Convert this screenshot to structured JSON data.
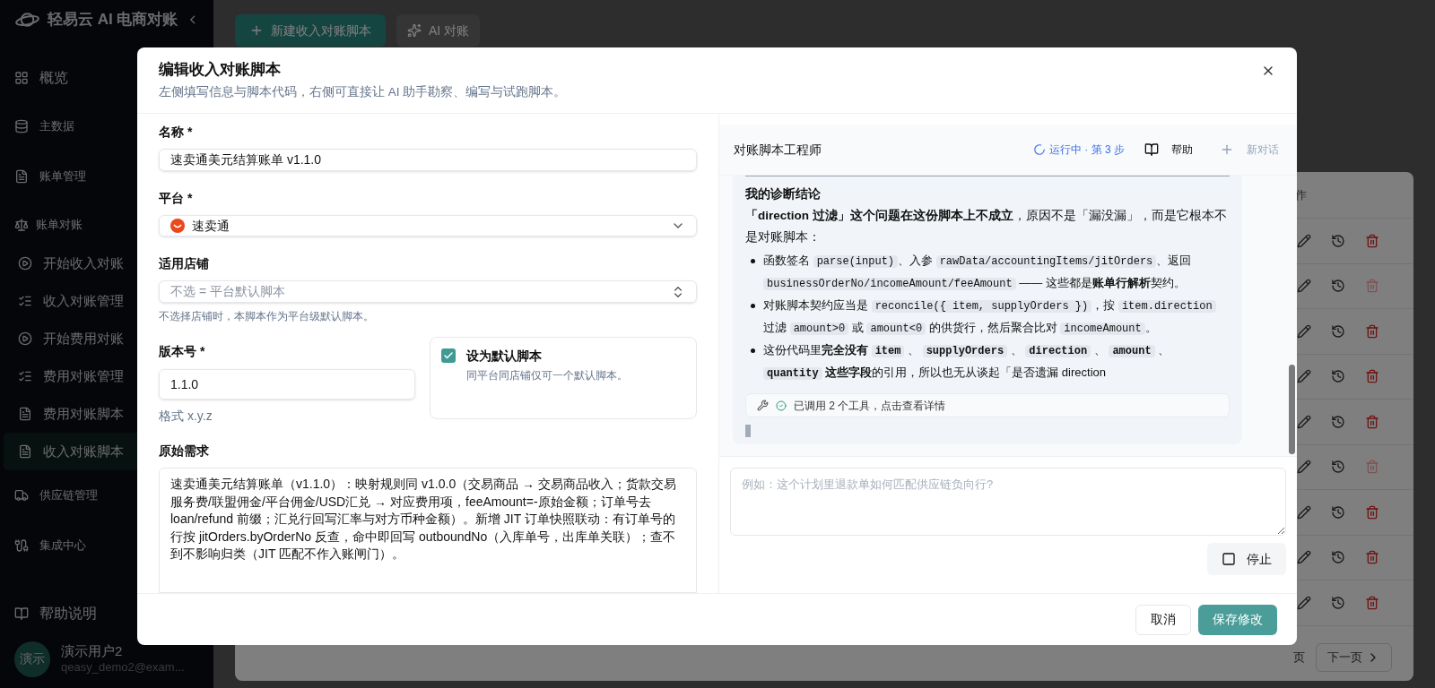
{
  "sidebar": {
    "brand": "轻易云 AI 电商对账",
    "items": [
      {
        "label": "概览",
        "kind": "link"
      },
      {
        "label": "主数据",
        "kind": "group"
      },
      {
        "label": "账单管理",
        "kind": "group"
      },
      {
        "label": "账单对账",
        "kind": "section",
        "children": [
          {
            "label": "开始收入对账",
            "selected": false
          },
          {
            "label": "收入对账管理",
            "selected": false
          },
          {
            "label": "开始费用对账",
            "selected": false
          },
          {
            "label": "费用对账管理",
            "selected": false
          },
          {
            "label": "费用对账脚本",
            "selected": false
          },
          {
            "label": "收入对账脚本",
            "selected": true
          }
        ]
      },
      {
        "label": "供应链管理",
        "kind": "group"
      },
      {
        "label": "集成中心",
        "kind": "group"
      },
      {
        "label": "帮助说明",
        "kind": "link"
      }
    ],
    "user": {
      "avatar": "演示",
      "name": "演示用户2",
      "email": "qeasy_demo2@exam..."
    }
  },
  "toolbar": [
    {
      "label": "新建收入对账脚本",
      "kind": "primary"
    },
    {
      "label": "AI 对账",
      "kind": "ghost"
    }
  ],
  "table": {
    "header": "作",
    "rows": [
      {
        "delete_disabled": false
      },
      {
        "delete_disabled": true
      },
      {
        "delete_disabled": false
      },
      {
        "delete_disabled": false
      },
      {
        "delete_disabled": false
      },
      {
        "delete_disabled": true
      },
      {
        "delete_disabled": false
      },
      {
        "delete_disabled": false
      },
      {
        "delete_disabled": false
      }
    ]
  },
  "pagination": {
    "info": "页",
    "next": "下一页"
  },
  "dialog": {
    "title": "编辑收入对账脚本",
    "subtitle": "左侧填写信息与脚本代码，右侧可直接让 AI 助手勘察、编写与试跑脚本。",
    "name": {
      "label": "名称 *",
      "value": "速卖通美元结算账单 v1.1.0"
    },
    "platform": {
      "label": "平台 *",
      "value": "速卖通"
    },
    "store": {
      "label": "适用店铺",
      "placeholder": "不选 = 平台默认脚本",
      "hint": "不选择店铺时，本脚本作为平台级默认脚本。"
    },
    "version": {
      "label": "版本号 *",
      "value": "1.1.0",
      "hint": "格式 x.y.z"
    },
    "default_script": {
      "label": "设为默认脚本",
      "description": "同平台同店铺仅可一个默认脚本。",
      "checked": true
    },
    "requirement": {
      "label": "原始需求",
      "value": "速卖通美元结算账单（v1.1.0）：映射规则同 v1.0.0（交易商品 → 交易商品收入；货款交易服务费/联盟佣金/平台佣金/USD汇兑 → 对应费用项，feeAmount=-原始金额；订单号去 loan/refund 前缀；汇兑行回写汇率与对方币种金额）。新增 JIT 订单快照联动：有订单号的行按 jitOrders.byOrderNo 反查，命中即回写 outboundNo（入库单号，出库单关联）；查不到不影响归类（JIT 匹配不作入账闸门）。"
    },
    "assistant": {
      "title": "对账脚本工程师",
      "status": "运行中 · 第 3 步",
      "help": "帮助",
      "new_chat": "新对话",
      "message": {
        "heading": "我的诊断结论",
        "intro": "**「direction 过滤」这个问题在这份脚本上不成立**，原因不是「漏没漏」，而是它根本不是对账脚本：",
        "bullets": [
          [
            {
              "kind": "text",
              "text": "函数签名 "
            },
            {
              "kind": "code",
              "text": "parse(input)"
            },
            {
              "kind": "text",
              "text": "、入参 "
            },
            {
              "kind": "code",
              "text": "rawData/accountingItems/jitOrders"
            },
            {
              "kind": "text",
              "text": "、返回 "
            },
            {
              "kind": "code",
              "text": "businessOrderNo/incomeAmount/feeAmount"
            },
            {
              "kind": "text",
              "text": " —— 这些都是**账单行解析**契约。"
            }
          ],
          [
            {
              "kind": "text",
              "text": "对账脚本契约应当是 "
            },
            {
              "kind": "code",
              "text": "reconcile({ item, supplyOrders })"
            },
            {
              "kind": "text",
              "text": "，按 "
            },
            {
              "kind": "code",
              "text": "item.direction"
            },
            {
              "kind": "text",
              "text": " 过滤 "
            },
            {
              "kind": "code",
              "text": "amount>0"
            },
            {
              "kind": "text",
              "text": " 或 "
            },
            {
              "kind": "code",
              "text": "amount<0"
            },
            {
              "kind": "text",
              "text": " 的供货行，然后聚合比对 "
            },
            {
              "kind": "code",
              "text": "incomeAmount"
            },
            {
              "kind": "text",
              "text": "。"
            }
          ],
          [
            {
              "kind": "text",
              "text": "这份代码里**完全没有** "
            },
            {
              "kind": "strong_code",
              "text": "item"
            },
            {
              "kind": "text",
              "text": " 、 "
            },
            {
              "kind": "strong_code",
              "text": "supplyOrders"
            },
            {
              "kind": "text",
              "text": " 、 "
            },
            {
              "kind": "strong_code",
              "text": "direction"
            },
            {
              "kind": "text",
              "text": " 、 "
            },
            {
              "kind": "strong_code",
              "text": "amount"
            },
            {
              "kind": "text",
              "text": " 、 "
            },
            {
              "kind": "strong_code",
              "text": "quantity"
            },
            {
              "kind": "text",
              "text": " **这些字段**的引用，所以也无从谈起「是否遗漏 direction"
            }
          ]
        ],
        "tool_call": "已调用 2 个工具，点击查看详情"
      },
      "input": {
        "placeholder": "例如：这个计划里退款单如何匹配供应链负向行?"
      },
      "stop": "停止"
    },
    "footer": {
      "cancel": "取消",
      "save": "保存修改"
    }
  }
}
